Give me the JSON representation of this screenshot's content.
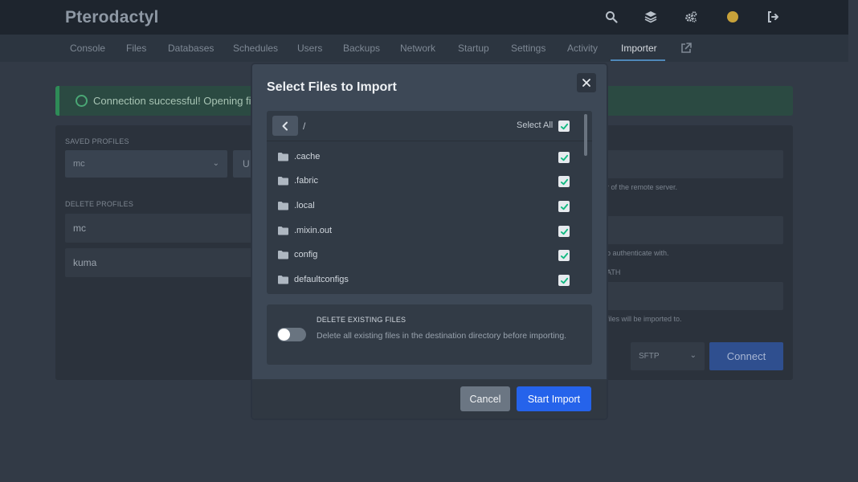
{
  "app": {
    "brand": "Pterodactyl"
  },
  "topbar": {
    "icons": [
      "search-icon",
      "layers-icon",
      "cogs-icon",
      "avatar",
      "sign-out-icon"
    ]
  },
  "nav": {
    "tabs": [
      {
        "label": "Console"
      },
      {
        "label": "Files"
      },
      {
        "label": "Databases"
      },
      {
        "label": "Schedules"
      },
      {
        "label": "Users"
      },
      {
        "label": "Backups"
      },
      {
        "label": "Network"
      },
      {
        "label": "Startup"
      },
      {
        "label": "Settings"
      },
      {
        "label": "Activity"
      },
      {
        "label": "Importer",
        "active": true
      }
    ],
    "external_icon": "external-link-icon"
  },
  "background": {
    "alert_text": "Connection successful! Opening file",
    "saved_profiles_label": "SAVED PROFILES",
    "saved_profile_value": "mc",
    "u_button_label": "U",
    "delete_profiles_label": "DELETE PROFILES",
    "profiles": [
      "mc",
      "kuma"
    ],
    "help_1": "r of the remote server.",
    "help_2": "o authenticate with.",
    "path_label_fragment": "ATH",
    "help_3": "files will be imported to.",
    "protocol_value": "SFTP",
    "connect_label": "Connect"
  },
  "modal": {
    "title": "Select Files to Import",
    "path": "/",
    "select_all_label": "Select All",
    "files": [
      {
        "name": ".cache",
        "checked": true
      },
      {
        "name": ".fabric",
        "checked": true
      },
      {
        "name": ".local",
        "checked": true
      },
      {
        "name": ".mixin.out",
        "checked": true
      },
      {
        "name": "config",
        "checked": true
      },
      {
        "name": "defaultconfigs",
        "checked": true
      }
    ],
    "delete_title": "DELETE EXISTING FILES",
    "delete_desc": "Delete all existing files in the destination directory before importing.",
    "delete_enabled": false,
    "cancel_label": "Cancel",
    "start_label": "Start Import"
  },
  "colors": {
    "accent": "#2563eb",
    "success": "#2e8b57",
    "checkmark": "#10b981"
  }
}
